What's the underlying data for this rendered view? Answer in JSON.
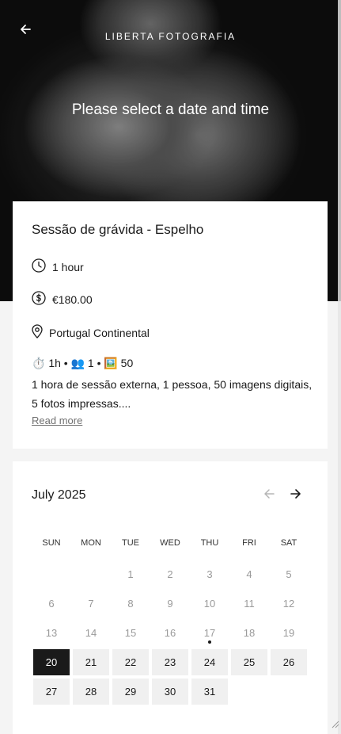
{
  "header": {
    "brand": "LIBERTA FOTOGRAFIA",
    "title": "Please select a date and time",
    "back_icon": "arrow-left-icon"
  },
  "service": {
    "title": "Sessão de grávida - Espelho",
    "duration": "1 hour",
    "price": "€180.00",
    "location": "Portugal Continental",
    "summary": "⏱️ 1h • 👥 1 • 🖼️ 50",
    "description": "1 hora de sessão externa, 1 pessoa, 50 imagens  digitais, 5 fotos impressas....",
    "read_more": "Read more"
  },
  "calendar": {
    "month_label": "July 2025",
    "prev_icon": "arrow-left-icon",
    "next_icon": "arrow-right-icon",
    "weekdays": [
      "SUN",
      "MON",
      "TUE",
      "WED",
      "THU",
      "FRI",
      "SAT"
    ],
    "days": [
      {
        "label": "",
        "state": "empty"
      },
      {
        "label": "",
        "state": "empty"
      },
      {
        "label": "1",
        "state": "disabled"
      },
      {
        "label": "2",
        "state": "disabled"
      },
      {
        "label": "3",
        "state": "disabled"
      },
      {
        "label": "4",
        "state": "disabled"
      },
      {
        "label": "5",
        "state": "disabled"
      },
      {
        "label": "6",
        "state": "disabled"
      },
      {
        "label": "7",
        "state": "disabled"
      },
      {
        "label": "8",
        "state": "disabled"
      },
      {
        "label": "9",
        "state": "disabled"
      },
      {
        "label": "10",
        "state": "disabled"
      },
      {
        "label": "11",
        "state": "disabled"
      },
      {
        "label": "12",
        "state": "disabled"
      },
      {
        "label": "13",
        "state": "disabled"
      },
      {
        "label": "14",
        "state": "disabled"
      },
      {
        "label": "15",
        "state": "disabled"
      },
      {
        "label": "16",
        "state": "disabled"
      },
      {
        "label": "17",
        "state": "today"
      },
      {
        "label": "18",
        "state": "disabled"
      },
      {
        "label": "19",
        "state": "disabled"
      },
      {
        "label": "20",
        "state": "selected"
      },
      {
        "label": "21",
        "state": "available"
      },
      {
        "label": "22",
        "state": "available"
      },
      {
        "label": "23",
        "state": "available"
      },
      {
        "label": "24",
        "state": "available"
      },
      {
        "label": "25",
        "state": "available"
      },
      {
        "label": "26",
        "state": "available"
      },
      {
        "label": "27",
        "state": "available"
      },
      {
        "label": "28",
        "state": "available"
      },
      {
        "label": "29",
        "state": "available"
      },
      {
        "label": "30",
        "state": "available"
      },
      {
        "label": "31",
        "state": "available"
      }
    ]
  },
  "colors": {
    "accent": "#1a1a1a",
    "available_bg": "#f0f0f0",
    "disabled_text": "#9a9a9a"
  }
}
